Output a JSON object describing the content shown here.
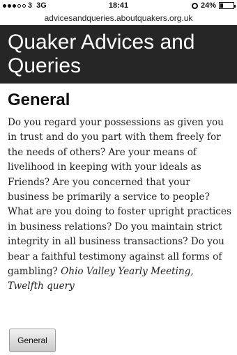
{
  "status_bar": {
    "carrier": "3",
    "network": "3G",
    "time": "18:41",
    "battery": "24%",
    "battery_level_percent": 24,
    "icons": [
      "signal-dots-icon",
      "alarm-icon",
      "battery-icon"
    ]
  },
  "browser": {
    "url": "advicesandqueries.aboutquakers.org.uk"
  },
  "header": {
    "title": "Quaker Advices and Queries"
  },
  "main": {
    "section_title": "General",
    "body": "Do you regard your possessions as given you in trust and do you part with them freely for the needs of others? Are your means of livelihood in keeping with your ideals as Friends? Are you concerned that your business be primarily a service to people? What are you doing to foster upright practices in business relations? Do you maintain strict integrity in all business transactions? Do you bear a faithful testimony against all forms of gambling?",
    "citation": "Ohio Valley Yearly Meeting, Twelfth query"
  },
  "footer": {
    "button_label": "General"
  },
  "colors": {
    "header_background": "#262626",
    "header_text": "#ffffff",
    "page_background": "#ffffff"
  }
}
